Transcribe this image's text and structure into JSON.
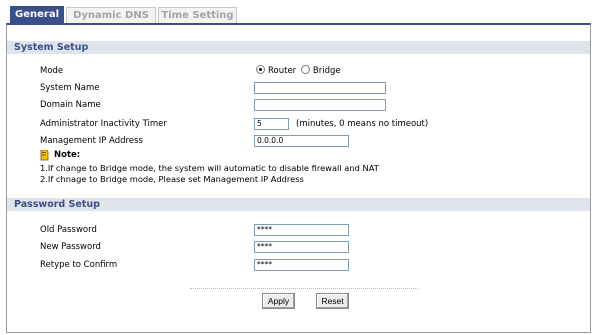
{
  "tabs": [
    {
      "label": "General",
      "active": true
    },
    {
      "label": "Dynamic DNS",
      "active": false
    },
    {
      "label": "Time Setting",
      "active": false
    }
  ],
  "system_setup": {
    "title": "System Setup",
    "mode_label": "Mode",
    "mode_options": [
      "Router",
      "Bridge"
    ],
    "mode_selected": "Router",
    "system_name_label": "System Name",
    "system_name_value": "",
    "domain_name_label": "Domain Name",
    "domain_name_value": "",
    "timer_label": "Administrator Inactivity Timer",
    "timer_value": "5",
    "timer_hint": "(minutes, 0 means no timeout)",
    "mgmt_ip_label": "Management IP Address",
    "mgmt_ip_value": "0.0.0.0"
  },
  "note": {
    "title": "Note:",
    "lines": [
      "1.If change to Bridge mode, the system will automatic to disable firewall and NAT",
      "2.If chnage to Bridge mode, Please set Management IP Address"
    ]
  },
  "password_setup": {
    "title": "Password Setup",
    "old_label": "Old Password",
    "old_value": "****",
    "new_label": "New Password",
    "new_value": "****",
    "confirm_label": "Retype to Confirm",
    "confirm_value": "****"
  },
  "buttons": {
    "apply": "Apply",
    "reset": "Reset"
  },
  "colors": {
    "tab_active_bg": "#3b4f8a",
    "section_header_bg": "#dfe3ea",
    "section_header_text": "#3b4f8a"
  }
}
